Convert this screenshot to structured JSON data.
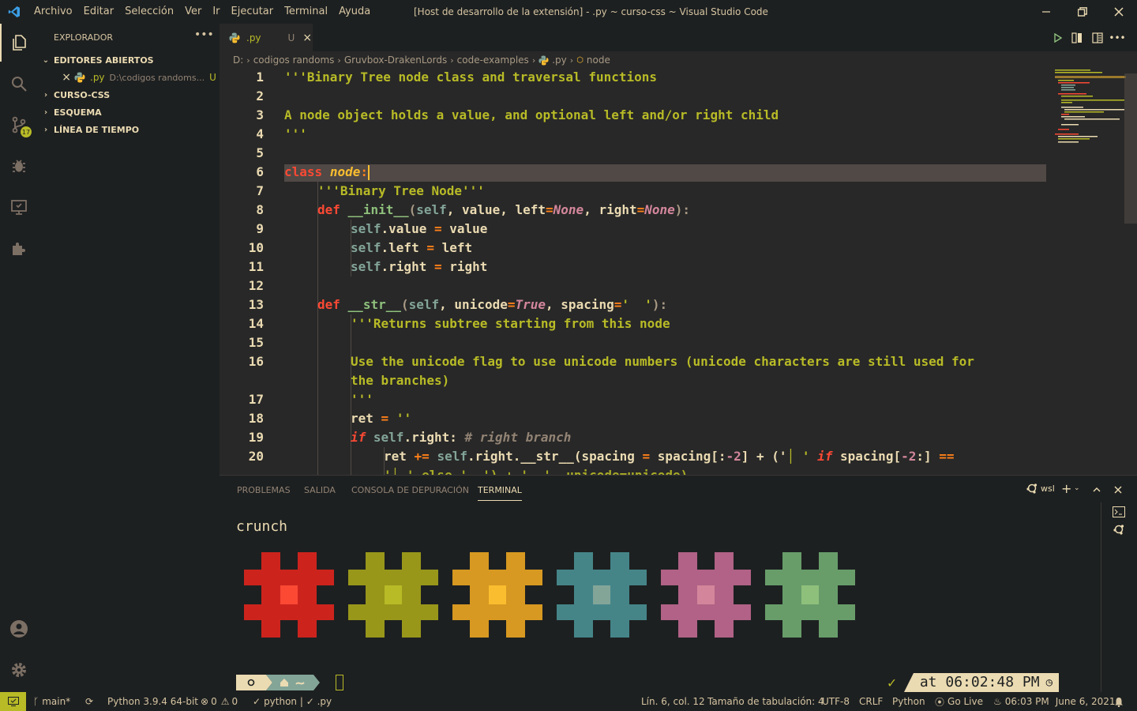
{
  "menu": [
    "Archivo",
    "Editar",
    "Selección",
    "Ver",
    "Ir",
    "Ejecutar",
    "Terminal",
    "Ayuda"
  ],
  "window_title": "[Host de desarrollo de la extensión] - .py ~ curso-css ~ Visual Studio Code",
  "source_control_badge": "17",
  "sidebar": {
    "title": "EXPLORADOR",
    "open_editors": "EDITORES ABIERTOS",
    "open_file_name": ".py",
    "open_file_path": "D:\\codigos randoms...",
    "open_file_status": "U",
    "sections": [
      "CURSO-CSS",
      "ESQUEMA",
      "LÍNEA DE TIEMPO"
    ]
  },
  "tab": {
    "label": ".py",
    "status": "U"
  },
  "breadcrumb": [
    "D:",
    "codigos randoms",
    "Gruvbox-DrakenLords",
    "code-examples",
    ".py",
    "node"
  ],
  "editor": {
    "line_numbers": [
      "1",
      "2",
      "3",
      "4",
      "5",
      "6",
      "7",
      "8",
      "9",
      "10",
      "11",
      "12",
      "13",
      "14",
      "15",
      "16",
      "",
      "17",
      "18",
      "19",
      "20"
    ],
    "code": {
      "l1": "'''Binary Tree node class and traversal functions",
      "l3": "A node object holds a value, and optional left and/or right child",
      "l4": "'''",
      "l6_kw": "class",
      "l6_name": "node",
      "l6_colon": ":",
      "l7": "'''Binary Tree Node'''",
      "l8_kw": "def",
      "l8_fn": "__init__",
      "l8_open": "(",
      "l8_self": "self",
      "l8_args": ", value, left",
      "l8_eq1": "=",
      "l8_none1": "None",
      "l8_right": ", right",
      "l8_eq2": "=",
      "l8_none2": "None",
      "l8_close": "):",
      "l9_self": "self",
      "l9_rest": ".value",
      "l9_eq": " = ",
      "l9_val": "value",
      "l10_self": "self",
      "l10_rest": ".left",
      "l10_eq": " = ",
      "l10_val": "left",
      "l11_self": "self",
      "l11_rest": ".right",
      "l11_eq": " = ",
      "l11_val": "right",
      "l13_kw": "def",
      "l13_fn": "__str__",
      "l13_open": "(",
      "l13_self": "self",
      "l13_args": ", unicode",
      "l13_eq1": "=",
      "l13_true": "True",
      "l13_sp": ", spacing",
      "l13_eq2": "=",
      "l13_str": "'  '",
      "l13_close": "):",
      "l14": "'''Returns subtree starting from this node",
      "l16a": "Use the unicode flag to use unicode numbers (unicode characters are still used for",
      "l16b": "the branches)",
      "l17": "'''",
      "l18_name": "ret",
      "l18_eq": " = ",
      "l18_str": "''",
      "l19_kw": "if",
      "l19_self": "self",
      "l19_rest": ".right:",
      "l19_cmt": "# right branch",
      "l20_name": "ret",
      "l20_op": " += ",
      "l20_self": "self",
      "l20_call": ".right.__str__(spacing",
      "l20_eq": " = ",
      "l20_spacing": "spacing[:",
      "l20_num1": "-2",
      "l20_mid": "] + ('",
      "l20_bar": "│",
      "l20_str2": " '",
      "l20_kw": "if",
      "l20_end": "spacing[",
      "l20_num2": "-2",
      "l20_end2": ":]",
      "l20_cmp": " ==",
      "l21_partial": "'│ ' else '  ') + '  ', unicode=unicode)"
    }
  },
  "panel": {
    "tabs": [
      "PROBLEMAS",
      "SALIDA",
      "CONSOLA DE DEPURACIÓN",
      "TERMINAL"
    ],
    "active_tab": "TERMINAL",
    "shell": "wsl",
    "terminal_title": "crunch",
    "prompt_time": "at 06:02:48 PM",
    "hash_colors": [
      {
        "main": "#cc241d",
        "center": "#fb4934"
      },
      {
        "main": "#98971a",
        "center": "#b8bb26"
      },
      {
        "main": "#d79921",
        "center": "#fabd2f"
      },
      {
        "main": "#458588",
        "center": "#83a598"
      },
      {
        "main": "#b16286",
        "center": "#d3869b"
      },
      {
        "main": "#689d6a",
        "center": "#8ec07c"
      }
    ]
  },
  "statusbar": {
    "branch": "main*",
    "python": "Python 3.9.4 64-bit",
    "errors": "0",
    "warnings": "0",
    "lint": "python | ✓ .py",
    "position": "Lín. 6, col. 12",
    "tab_size": "Tamaño de tabulación: 4",
    "encoding": "UTF-8",
    "eol": "CRLF",
    "language": "Python",
    "go_live": "Go Live",
    "time": "06:03 PM",
    "date": "June 6, 2021"
  },
  "colors": {
    "background": "#282828",
    "background_dark": "#1d2021",
    "red": "#fb4934",
    "green": "#b8bb26",
    "yellow": "#fabd2f",
    "blue": "#83a598",
    "purple": "#d3869b",
    "aqua": "#8ec07c",
    "orange": "#fe8019",
    "accent_status": "#b8bb26"
  }
}
